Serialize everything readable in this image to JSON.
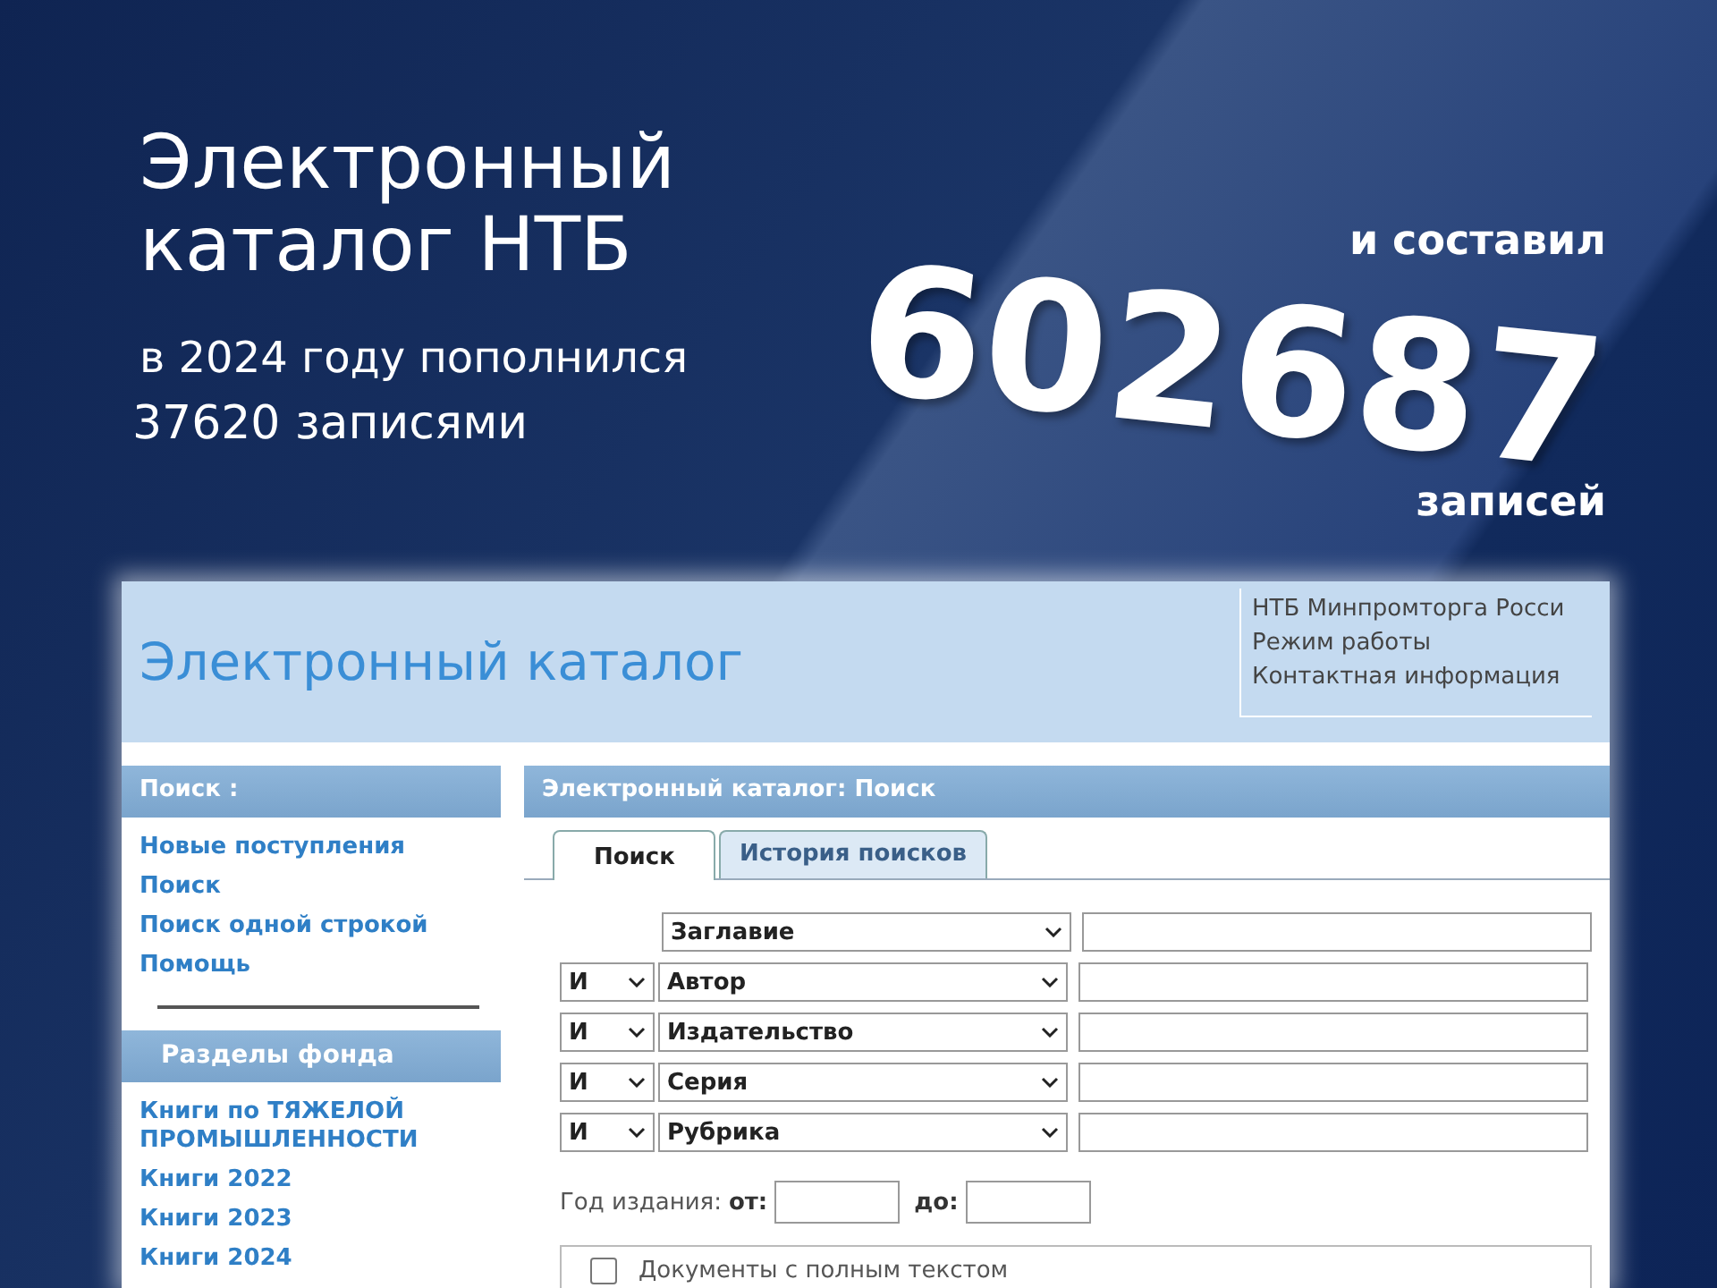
{
  "headline": {
    "title_lines": [
      "Электронный",
      "каталог НТБ"
    ],
    "subtitle": "в 2024 году пополнился",
    "added": "37620 записями"
  },
  "total": {
    "lead": "и составил",
    "number": "602687",
    "unit": "записей"
  },
  "catalog": {
    "title": "Электронный каталог",
    "header_links": [
      "НТБ Минпромторга Росси",
      "Режим работы",
      "Контактная информация"
    ],
    "sidebar": {
      "search_heading": "Поиск :",
      "search_links": [
        "Новые поступления",
        "Поиск",
        "Поиск одной строкой",
        "Помощь"
      ],
      "sections_heading": "Разделы фонда",
      "section_links": [
        "Книги по ТЯЖЕЛОЙ ПРОМЫШЛЕННОСТИ",
        "Книги 2022",
        "Книги 2023",
        "Книги 2024"
      ]
    },
    "main": {
      "heading": "Электронный каталог: Поиск",
      "tabs": [
        {
          "label": "Поиск",
          "selected": true
        },
        {
          "label": "История поисков",
          "selected": false
        }
      ],
      "criteria": [
        {
          "field": "Заглавие"
        },
        {
          "operator": "И",
          "field": "Автор"
        },
        {
          "operator": "И",
          "field": "Издательство"
        },
        {
          "operator": "И",
          "field": "Серия"
        },
        {
          "operator": "И",
          "field": "Рубрика"
        }
      ],
      "year": {
        "label": "Год издания:",
        "from": "от:",
        "to": "до:"
      },
      "full_text": {
        "label": "Документы с полным текстом",
        "checked": false
      }
    }
  }
}
